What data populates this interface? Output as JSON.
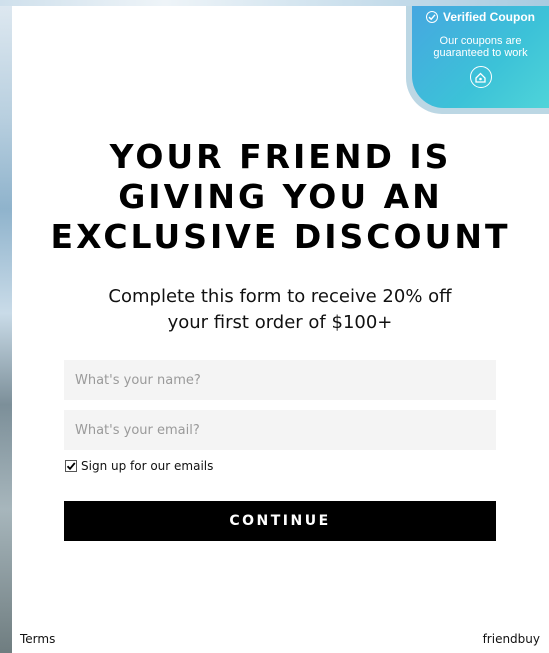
{
  "badge": {
    "title": "Verified Coupon",
    "text": "Our coupons are guaranteed to work",
    "icon": "check-circle-icon",
    "logo_icon": "friendbuy-logo-icon"
  },
  "headline": {
    "line1": "YOUR FRIEND IS",
    "line2": "GIVING YOU AN",
    "line3": "EXCLUSIVE DISCOUNT"
  },
  "subtitle": {
    "line1": "Complete this form to receive 20% off",
    "line2": "your first order of $100+"
  },
  "form": {
    "name_placeholder": "What's your name?",
    "email_placeholder": "What's your email?",
    "optin_label": "Sign up for our emails",
    "optin_checked": true,
    "continue_label": "CONTINUE"
  },
  "footer": {
    "terms_label": "Terms",
    "brand_label": "friendbuy"
  },
  "colors": {
    "badge_gradient_start": "#46a7e0",
    "badge_gradient_end": "#4fd4d9",
    "button_bg": "#000000",
    "field_bg": "#f4f4f4"
  }
}
